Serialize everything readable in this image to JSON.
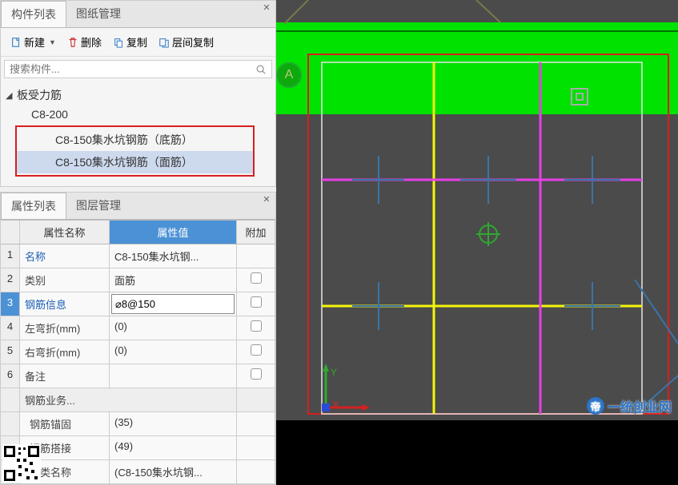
{
  "top_panel": {
    "tabs": {
      "component_list": "构件列表",
      "drawing_mgmt": "图纸管理"
    },
    "toolbar": {
      "new_label": "新建",
      "delete_label": "删除",
      "copy_label": "复制",
      "layer_copy_label": "层间复制"
    },
    "search_placeholder": "搜索构件...",
    "tree": {
      "root": "板受力筋",
      "child": "C8-200",
      "sub1": "C8-150集水坑钢筋（底筋）",
      "sub2": "C8-150集水坑钢筋（面筋）"
    }
  },
  "bottom_panel": {
    "tabs": {
      "prop_list": "属性列表",
      "layer_mgmt": "图层管理"
    },
    "headers": {
      "name": "属性名称",
      "value": "属性值",
      "addon": "附加"
    },
    "rows": [
      {
        "num": "1",
        "name": "名称",
        "value": "C8-150集水坑钢...",
        "link": true
      },
      {
        "num": "2",
        "name": "类别",
        "value": "面筋"
      },
      {
        "num": "3",
        "name": "钢筋信息",
        "value": "⌀8@150",
        "editing": true,
        "selected": true
      },
      {
        "num": "4",
        "name": "左弯折(mm)",
        "value": "(0)"
      },
      {
        "num": "5",
        "name": "右弯折(mm)",
        "value": "(0)"
      },
      {
        "num": "6",
        "name": "备注",
        "value": ""
      }
    ],
    "sub_header": "钢筋业务...",
    "sub_rows": [
      {
        "name": "钢筋锚固",
        "value": "(35)"
      },
      {
        "name": "钢筋搭接",
        "value": "(49)"
      },
      {
        "name": "归类名称",
        "value": "(C8-150集水坑钢..."
      }
    ]
  },
  "viewport": {
    "axis_marker": "A",
    "x_label": "X",
    "y_label": "Y"
  },
  "watermark": {
    "seal": "帝",
    "text": "一统创业网"
  }
}
